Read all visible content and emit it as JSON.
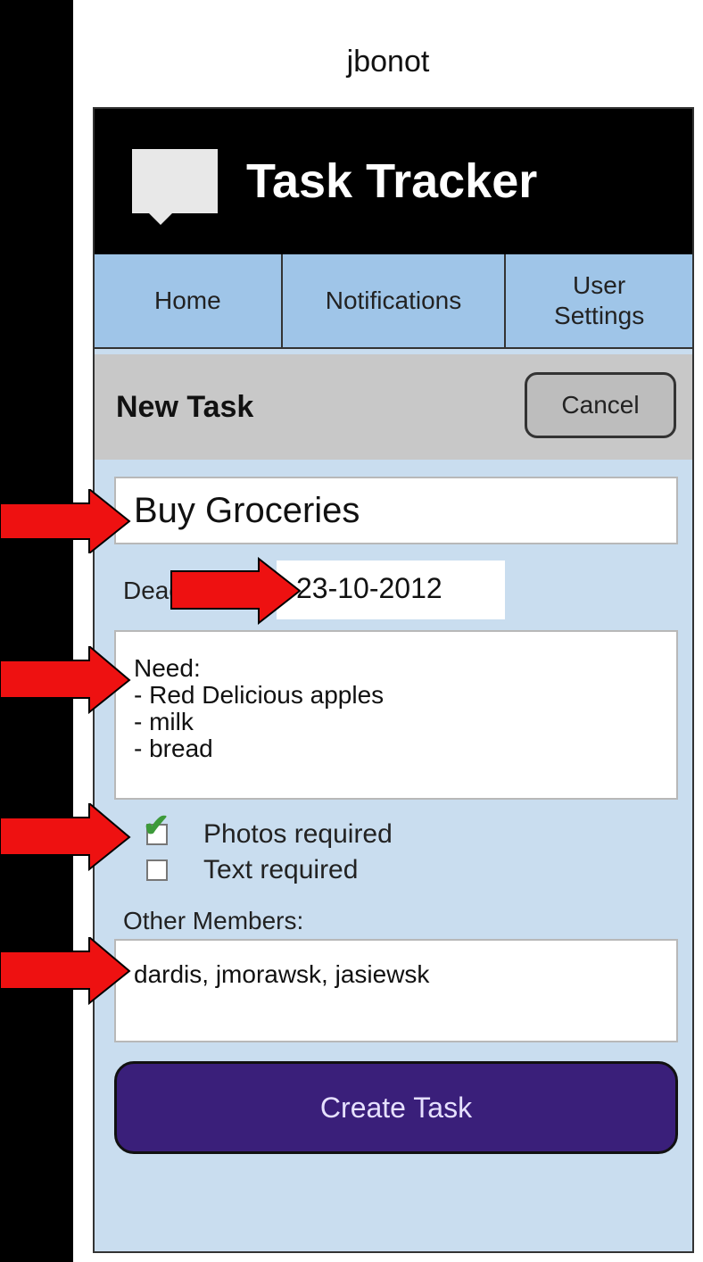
{
  "username": "jbonot",
  "app": {
    "title": "Task Tracker",
    "logo": "chat-bubble-icon"
  },
  "nav": [
    {
      "label": "Home"
    },
    {
      "label": "Notifications"
    },
    {
      "label": "User\nSettings"
    }
  ],
  "panel": {
    "title": "New Task",
    "cancel_label": "Cancel"
  },
  "form": {
    "task_name": "Buy Groceries",
    "deadline_label": "Deadline",
    "deadline_value": "23-10-2012",
    "notes": [
      "Need:",
      "- Red Delicious apples",
      "- milk",
      "- bread"
    ],
    "photos_required": {
      "label": "Photos required",
      "checked": true
    },
    "text_required": {
      "label": "Text required",
      "checked": false
    },
    "members_label": "Other Members:",
    "members_value": "dardis, jmorawsk, jasiewsk",
    "create_label": "Create Task"
  },
  "colors": {
    "annotation_arrow": "#ee1111",
    "create_button": "#3a1f7a",
    "nav_bg": "#9fc5e8",
    "panel_bg": "#c9ddef"
  }
}
